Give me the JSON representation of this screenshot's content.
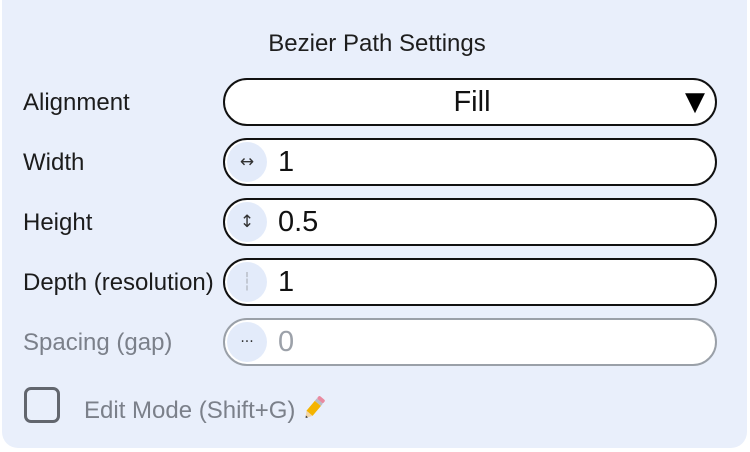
{
  "panel": {
    "title": "Bezier Path Settings"
  },
  "alignment": {
    "label": "Alignment",
    "selected": "Fill",
    "caret_icon": "triangle-down-icon"
  },
  "width": {
    "label": "Width",
    "icon_glyph": "↔",
    "icon_name": "horizontal-arrows-icon",
    "value": "1"
  },
  "height": {
    "label": "Height",
    "icon_glyph": "↕",
    "icon_name": "vertical-arrows-icon",
    "value": "0.5"
  },
  "depth": {
    "label": "Depth (resolution)",
    "icon_glyph": "┆",
    "icon_name": "dotted-line-icon",
    "value": "1"
  },
  "spacing": {
    "label": "Spacing (gap)",
    "icon_glyph": "···",
    "icon_name": "ellipsis-icon",
    "value": "0",
    "disabled": true
  },
  "edit_mode": {
    "label": "Edit Mode (Shift+G)",
    "checked": false,
    "icon_name": "pencil-icon"
  },
  "colors": {
    "panel_bg": "#e9effb",
    "badge_bg": "#e3ebfa",
    "disabled_text": "#7b808a",
    "border": "#111111",
    "pencil_body": "#f4b400"
  }
}
